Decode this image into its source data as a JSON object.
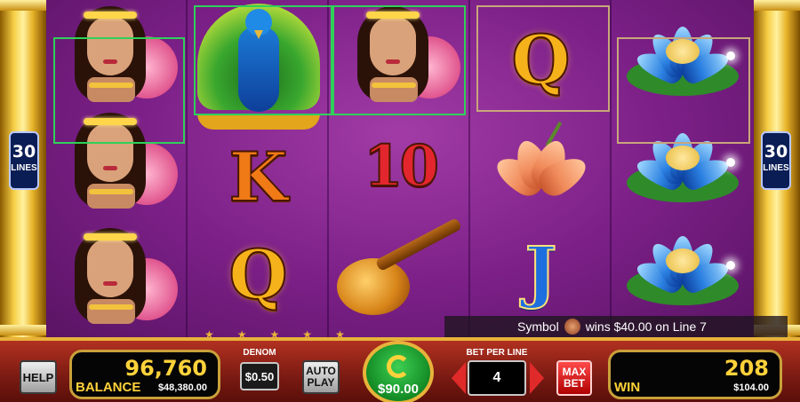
{
  "side": {
    "lines_number": "30",
    "lines_label": "LINES"
  },
  "reels": [
    [
      "lady",
      "lady",
      "lady"
    ],
    [
      "peacock",
      "K",
      "Q"
    ],
    [
      "lady",
      "10",
      "sitar"
    ],
    [
      "Q",
      "lily",
      "J"
    ],
    [
      "blue-lotus",
      "blue-lotus",
      "blue-lotus"
    ]
  ],
  "symbol_text": {
    "K": "K",
    "Q": "Q",
    "10": "10",
    "J": "J"
  },
  "win_message": {
    "prefix": "Symbol",
    "text": "wins $40.00 on Line 7"
  },
  "panel": {
    "help_label": "HELP",
    "balance_credits": "96,760",
    "balance_label": "BALANCE",
    "balance_amount": "$48,380.00",
    "denom_label": "DENOM",
    "denom_value": "$0.50",
    "auto_play_label": "AUTO PLAY",
    "spin_amount": "$90.00",
    "bet_per_line_label": "BET PER LINE",
    "bet_per_line_value": "4",
    "max_bet_label": "MAX BET",
    "win_credits": "208",
    "win_label": "WIN",
    "win_amount": "$104.00"
  },
  "colors": {
    "win_highlight": "#2ed158",
    "secondary_highlight": "#c9a67a",
    "meter_text": "#ffd23a",
    "frame_gold": "#e8b33a"
  }
}
